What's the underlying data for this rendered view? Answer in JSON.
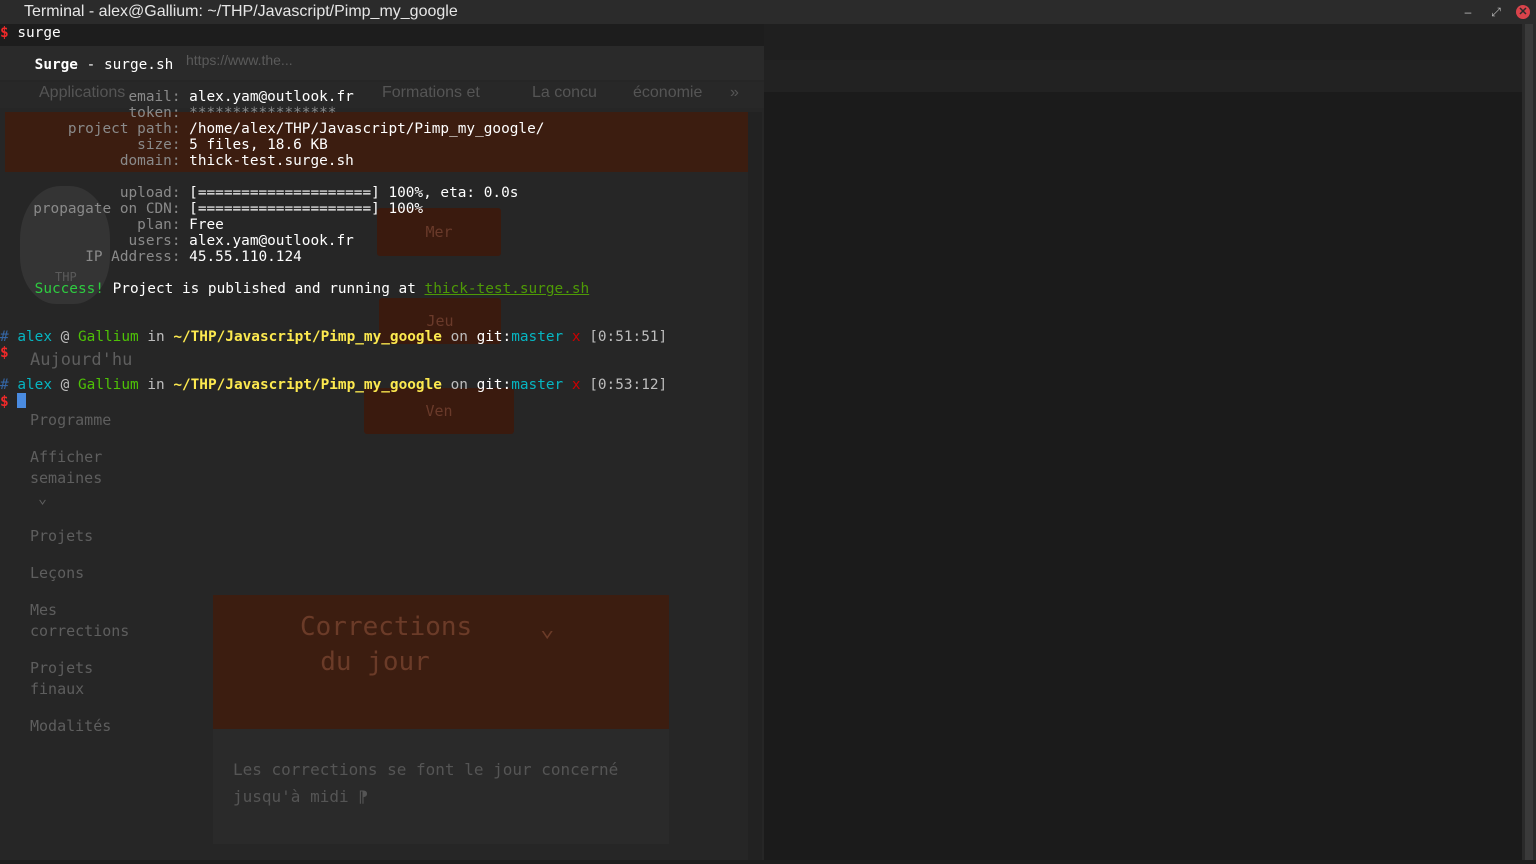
{
  "window": {
    "title": "Terminal - alex@Gallium: ~/THP/Javascript/Pimp_my_google",
    "min_label": "–",
    "max_label": "⤢",
    "close_label": "✕"
  },
  "terminal": {
    "prompt_symbol": "$",
    "command": "surge",
    "header_name": "Surge",
    "header_sep": " - ",
    "header_url": "surge.sh",
    "info": [
      {
        "label": "email:",
        "value": "alex.yam@outlook.fr"
      },
      {
        "label": "token:",
        "value": "*****************"
      },
      {
        "label": "project path:",
        "value": "/home/alex/THP/Javascript/Pimp_my_google/"
      },
      {
        "label": "size:",
        "value": "5 files, 18.6 KB"
      },
      {
        "label": "domain:",
        "value": "thick-test.surge.sh"
      }
    ],
    "progress": [
      {
        "label": "upload:",
        "value": "[====================] 100%, eta: 0.0s"
      },
      {
        "label": "propagate on CDN:",
        "value": "[====================] 100%"
      },
      {
        "label": "plan:",
        "value": "Free"
      },
      {
        "label": "users:",
        "value": "alex.yam@outlook.fr"
      },
      {
        "label": "IP Address:",
        "value": "45.55.110.124"
      }
    ],
    "success_word": "Success!",
    "success_text": " Project is published and running at ",
    "success_link": "thick-test.surge.sh",
    "prompts": [
      {
        "hash": "#",
        "user": "alex",
        "at": " @ ",
        "host": "Gallium",
        "in": " in ",
        "path": "~/THP/Javascript/Pimp_my_google",
        "on": " on ",
        "git": "git:",
        "branch": "master",
        "dirty": "x",
        "time": "[0:51:51]"
      },
      {
        "hash": "#",
        "user": "alex",
        "at": " @ ",
        "host": "Gallium",
        "in": " in ",
        "path": "~/THP/Javascript/Pimp_my_google",
        "on": " on ",
        "git": "git:",
        "branch": "master",
        "dirty": "x",
        "time": "[0:53:12]"
      }
    ]
  },
  "background_browser": {
    "address": "https://www.the...",
    "bookmarks": [
      "Applications",
      "Formations et",
      "La concu",
      "économie",
      "»"
    ],
    "logo_text": "THP",
    "calendar_buttons": [
      "Mer",
      "Jeu",
      "Ven"
    ],
    "today": "Aujourd'hu",
    "nav": [
      "Programme",
      "Afficher semaines",
      "Projets",
      "Leçons",
      "Mes corrections",
      "Projets finaux",
      "Modalités"
    ],
    "chevron": "⌄",
    "card_title": "Corrections du jour",
    "card_text": "Les corrections se font le jour concerné jusqu'à midi ⁋"
  }
}
